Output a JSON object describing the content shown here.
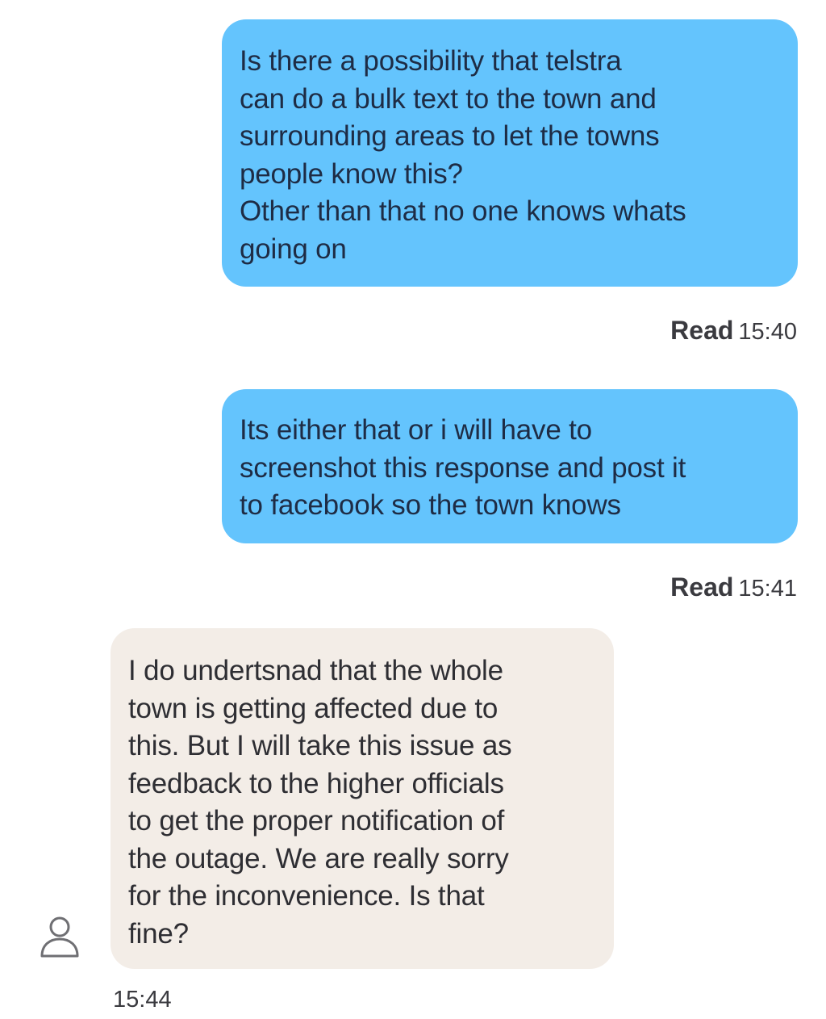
{
  "messages": [
    {
      "direction": "outgoing",
      "text": "Is there a possibility that telstra\ncan do a bulk text to the town and\nsurrounding areas to let the towns\npeople know this?\nOther than that no one knows whats\ngoing on",
      "status_label": "Read",
      "time": "15:40"
    },
    {
      "direction": "outgoing",
      "text": "Its either that or i will have to\nscreenshot this response and post it\nto facebook so the town knows",
      "status_label": "Read",
      "time": "15:41"
    },
    {
      "direction": "incoming",
      "text": "I do undertsnad that the whole\ntown is getting affected due to\nthis. But I will take this issue as\nfeedback to the higher officials\nto get the proper notification of\nthe outage. We are really sorry\nfor the inconvenience. Is that\nfine?",
      "time": "15:44",
      "avatar_icon": "user-outline-icon"
    }
  ],
  "colors": {
    "outgoing_bubble": "#64c4fd",
    "incoming_bubble": "#f3ede7",
    "background": "#ffffff"
  }
}
